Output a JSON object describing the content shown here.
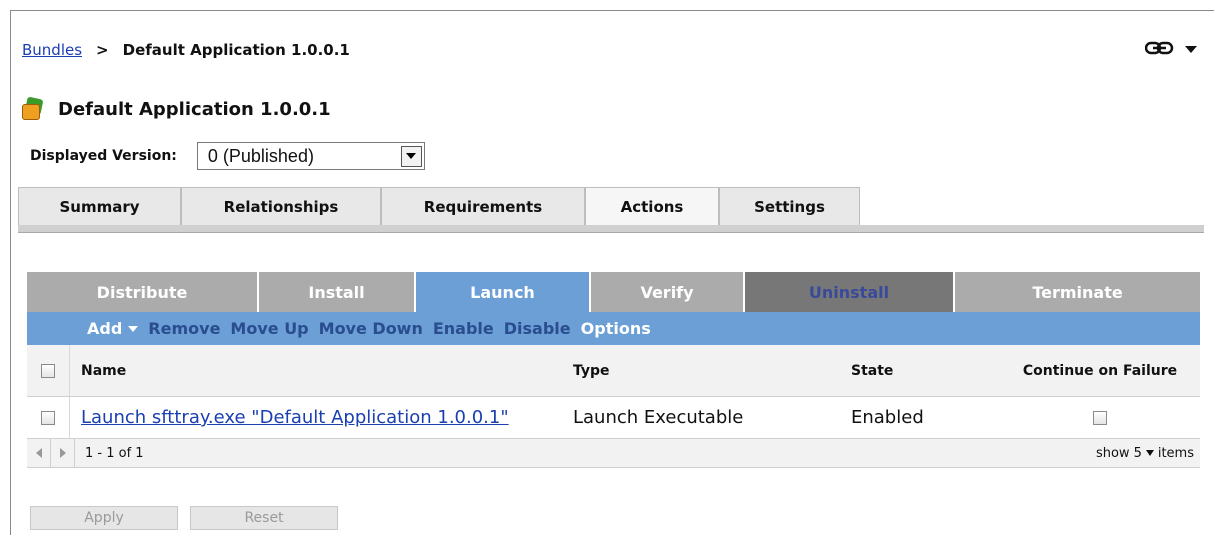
{
  "breadcrumb": {
    "root_label": "Bundles",
    "separator": ">",
    "current": "Default Application 1.0.0.1"
  },
  "header_icons": [
    "link-icon",
    "chevron-down-icon"
  ],
  "page_title": "Default Application 1.0.0.1",
  "version": {
    "label": "Displayed Version:",
    "value": "0 (Published)"
  },
  "tabs": [
    {
      "label": "Summary",
      "active": false
    },
    {
      "label": "Relationships",
      "active": false
    },
    {
      "label": "Requirements",
      "active": false
    },
    {
      "label": "Actions",
      "active": true
    },
    {
      "label": "Settings",
      "active": false
    }
  ],
  "action_tabs": [
    {
      "label": "Distribute"
    },
    {
      "label": "Install"
    },
    {
      "label": "Launch",
      "active": true
    },
    {
      "label": "Verify"
    },
    {
      "label": "Uninstall"
    },
    {
      "label": "Terminate"
    }
  ],
  "toolbar": {
    "add": "Add",
    "remove": "Remove",
    "move_up": "Move Up",
    "move_down": "Move Down",
    "enable": "Enable",
    "disable": "Disable",
    "options": "Options"
  },
  "table": {
    "headers": {
      "name": "Name",
      "type": "Type",
      "state": "State",
      "continue": "Continue on Failure"
    },
    "rows": [
      {
        "name": "Launch sfttray.exe \"Default Application 1.0.0.1\"",
        "type": "Launch Executable",
        "state": "Enabled",
        "continue_on_failure": false
      }
    ]
  },
  "pager": {
    "range": "1 - 1 of 1",
    "show": "show",
    "count": "5",
    "items": "items"
  },
  "buttons": {
    "apply": "Apply",
    "reset": "Reset"
  },
  "colors": {
    "accent_blue": "#6b9fd6",
    "tab_gray": "#ababab",
    "link": "#1a3fb0"
  }
}
